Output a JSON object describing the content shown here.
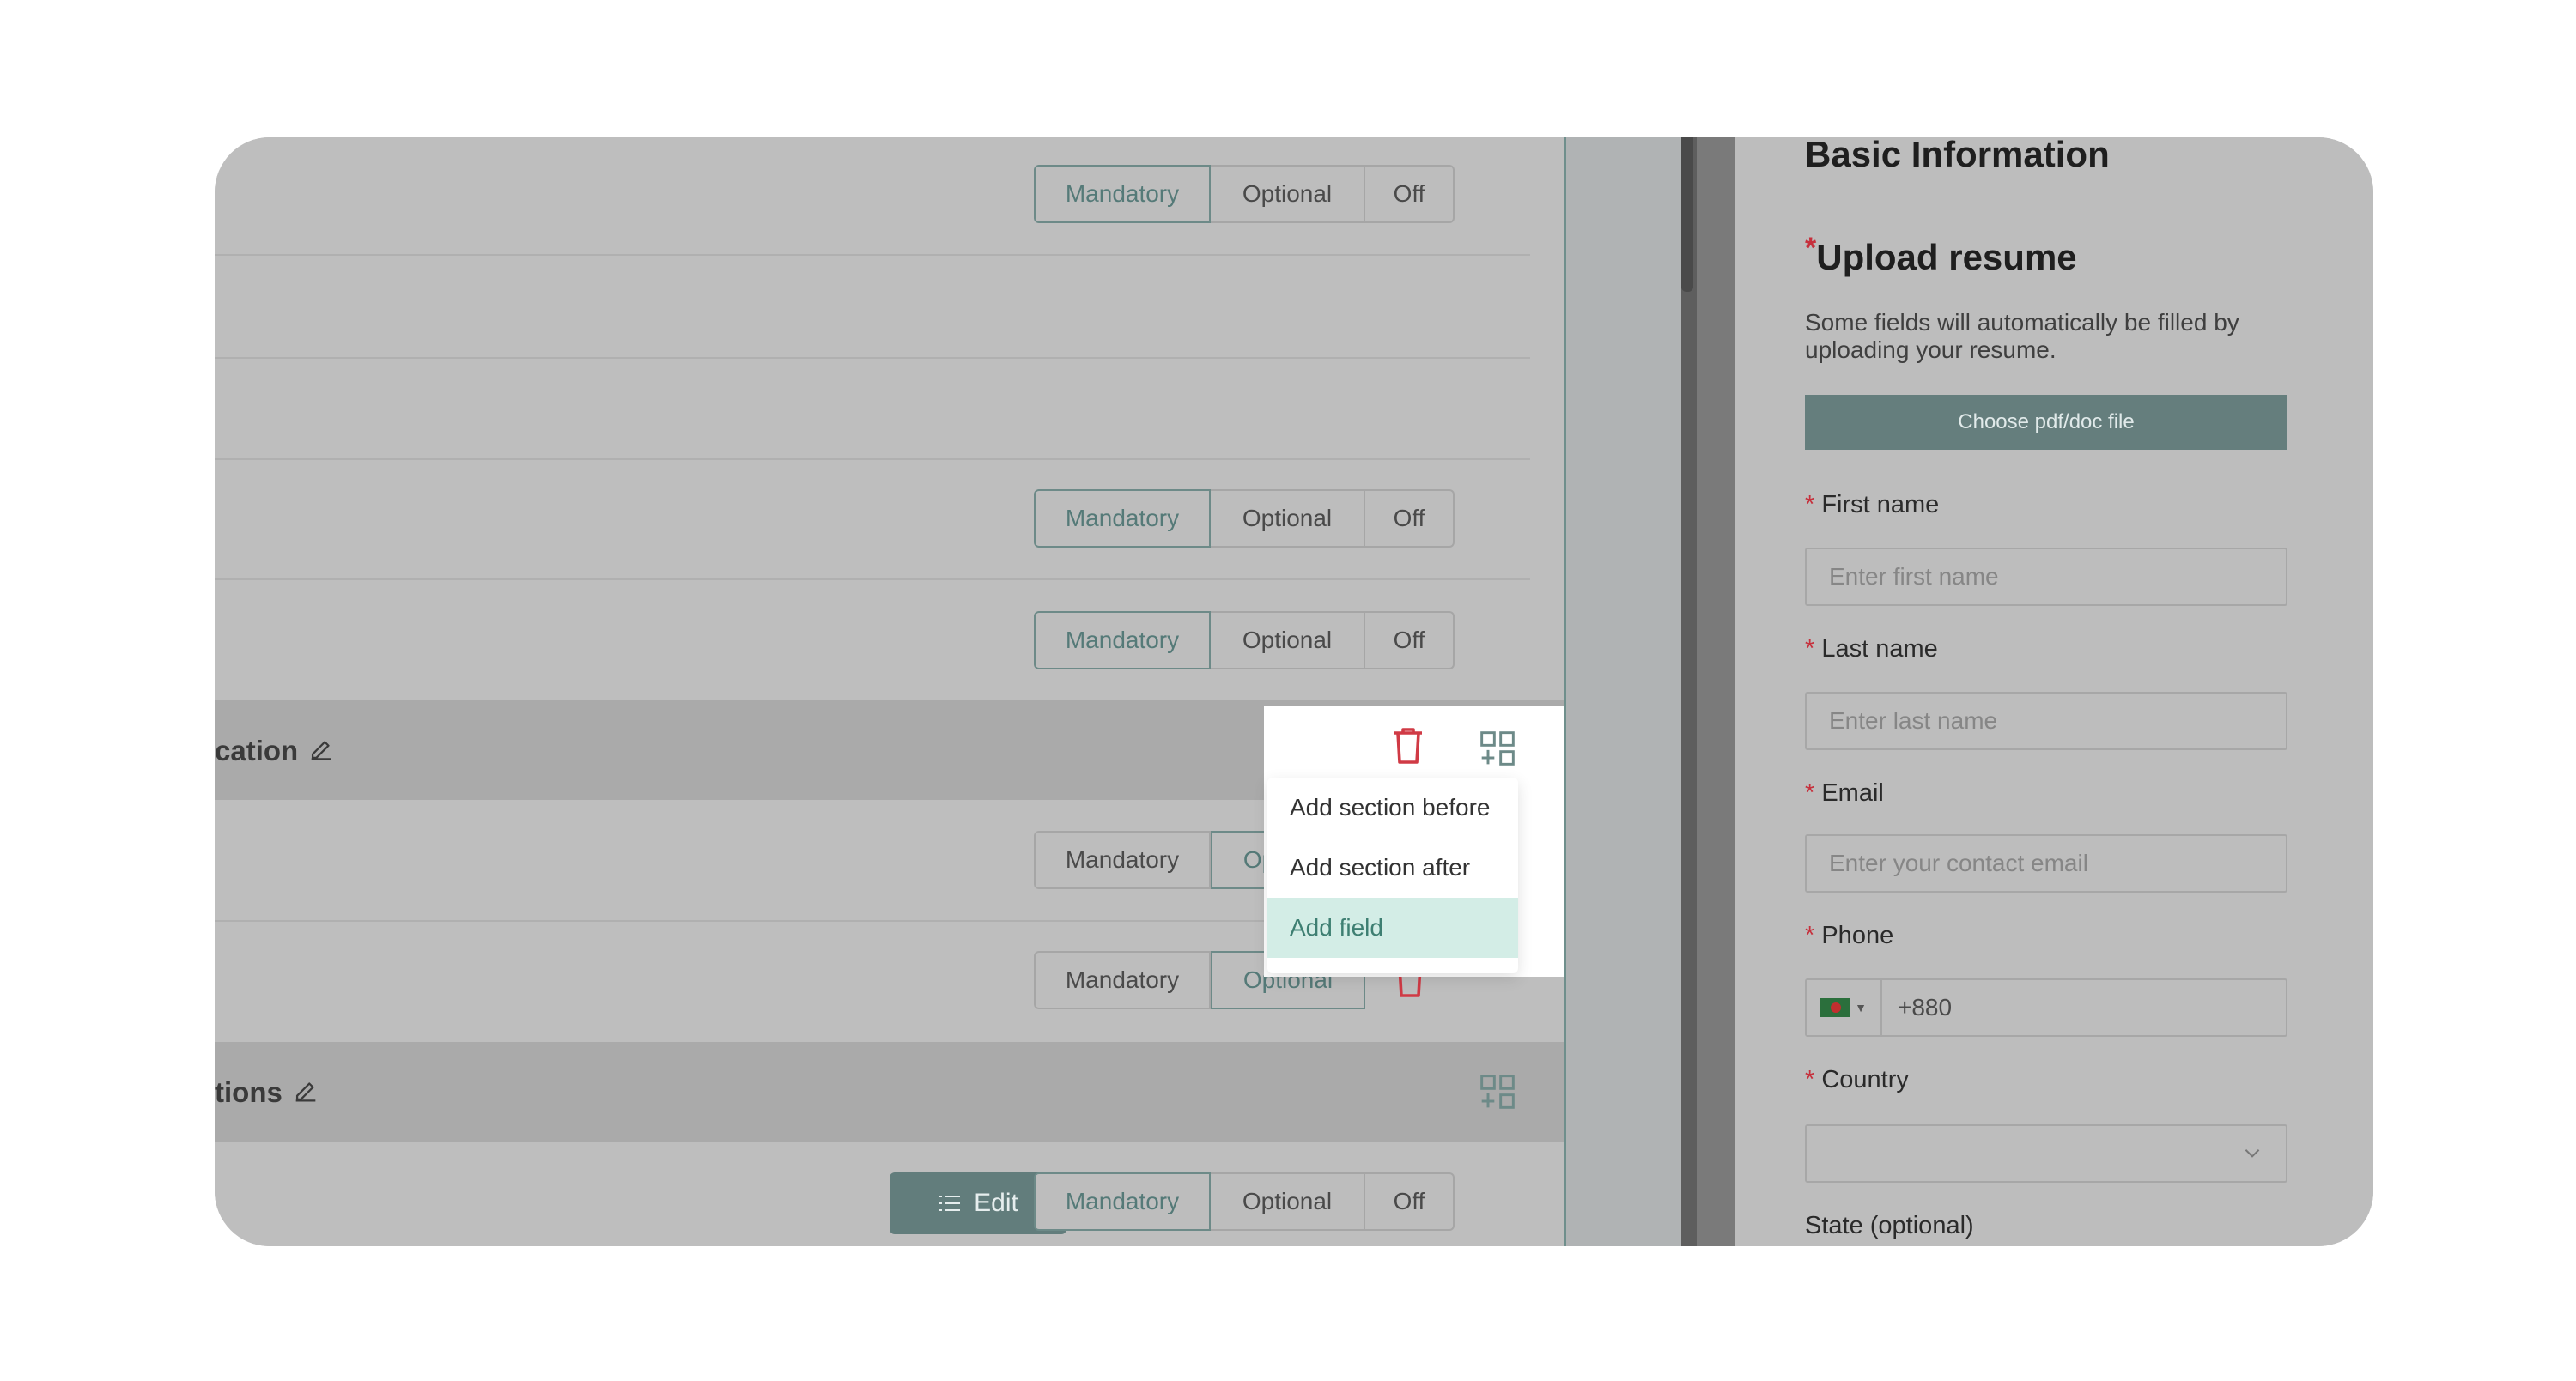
{
  "builder": {
    "seg_labels": {
      "mandatory": "Mandatory",
      "optional": "Optional",
      "off": "Off"
    },
    "sections": [
      {
        "title": "cation"
      },
      {
        "title": "tions"
      }
    ],
    "edit_label": "Edit",
    "menu": {
      "items": [
        "Add section before",
        "Add section after",
        "Add field"
      ],
      "highlighted": "Add field"
    }
  },
  "preview": {
    "heading": "Basic Information",
    "upload_title": "Upload resume",
    "upload_note": "Some fields will automatically be filled by uploading your resume.",
    "choose_label": "Choose pdf/doc file",
    "first_name": {
      "label": "First name",
      "placeholder": "Enter first name"
    },
    "last_name": {
      "label": "Last name",
      "placeholder": "Enter last name"
    },
    "email": {
      "label": "Email",
      "placeholder": "Enter your contact email"
    },
    "phone": {
      "label": "Phone",
      "value": "+880"
    },
    "country": {
      "label": "Country",
      "value": ""
    },
    "state": {
      "label": "State (optional)"
    }
  },
  "colors": {
    "accent": "#627d7c",
    "danger": "#d03a45",
    "menu_highlight": "#d3ede6"
  }
}
